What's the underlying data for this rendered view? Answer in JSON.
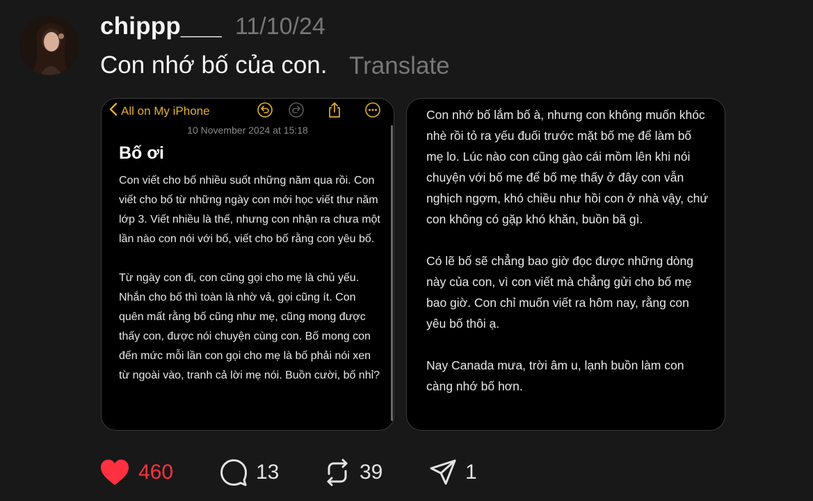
{
  "post": {
    "username": "chippp___",
    "timestamp": "11/10/24",
    "caption": "Con nhớ bố của con.",
    "translate_label": "Translate"
  },
  "note_left": {
    "back_label": "All on My iPhone",
    "date": "10 November 2024 at 15:18",
    "title": "Bố ơi",
    "paragraphs": [
      "Con viết cho bố nhiều suốt những năm qua rồi. Con viết cho bố từ những ngày con mới học viết thư năm lớp 3. Viết nhiều là thế, nhưng con nhận ra chưa một lần nào con nói với bố, viết cho bố rằng con yêu bố.",
      "Từ ngày con đi, con cũng gọi cho mẹ là chủ yếu. Nhắn cho bố thì toàn là nhờ vả, gọi cũng ít. Con quên mất rằng bố cũng như mẹ, cũng mong được thấy con, được nói chuyện cùng con. Bố mong con đến mức mỗi lần con gọi cho mẹ là bố phải nói xen từ ngoài vào, tranh cả lời mẹ nói. Buồn cười, bố nhỉ?"
    ],
    "icons": [
      "chevron-left-icon",
      "undo-icon",
      "redo-icon",
      "share-icon",
      "more-icon"
    ]
  },
  "note_right": {
    "paragraphs": [
      "Con nhớ bố lắm bố à, nhưng con không muốn khóc nhè rồi tỏ ra yếu đuối trước mặt bố mẹ để làm bố mẹ lo. Lúc nào con cũng gào cái mồm lên khi nói chuyện với bố mẹ để bố mẹ thấy ở đây con vẫn nghịch ngợm, khó chiều như hồi con ở nhà vậy, chứ con không có gặp khó khăn, buồn bã gì.",
      "Có lẽ bố sẽ chẳng bao giờ đọc được những dòng này của con, vì con viết mà chẳng gửi cho bố mẹ bao giờ. Con chỉ muốn viết ra hôm nay, rằng con yêu bố thôi ạ.",
      "Nay Canada mưa, trời âm u, lạnh buồn làm con càng nhớ bố hơn."
    ]
  },
  "actions": {
    "likes": "460",
    "comments": "13",
    "reposts": "39",
    "shares": "1"
  },
  "colors": {
    "background": "#181818",
    "like": "#ff3040",
    "notes_accent": "#e3b02f",
    "muted": "#777777"
  }
}
